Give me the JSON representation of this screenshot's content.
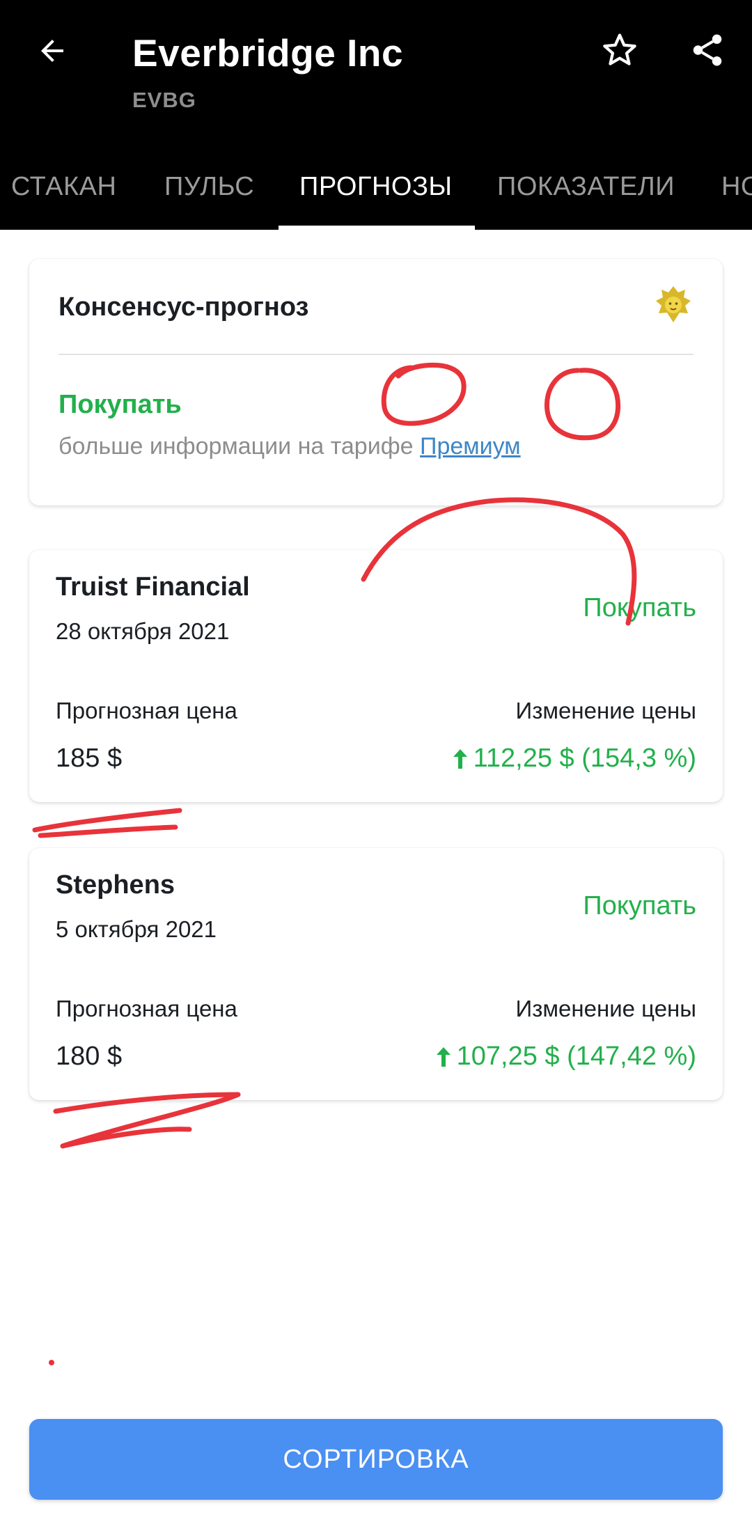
{
  "header": {
    "back_icon": "arrow-left-icon",
    "title": "Everbridge Inc",
    "ticker": "EVBG",
    "star_icon": "star-outline-icon",
    "share_icon": "share-icon"
  },
  "tabs": [
    {
      "label": "СТАКАН",
      "active": false
    },
    {
      "label": "ПУЛЬС",
      "active": false
    },
    {
      "label": "ПРОГНОЗЫ",
      "active": true
    },
    {
      "label": "ПОКАЗАТЕЛИ",
      "active": false
    },
    {
      "label": "НО",
      "active": false
    }
  ],
  "consensus": {
    "title": "Консенсус-прогноз",
    "badge_icon": "premium-lion-icon",
    "recommendation": "Покупать",
    "info_text": "больше информации на тарифе ",
    "link_text": "Премиум"
  },
  "forecasts": [
    {
      "broker": "Truist Financial",
      "date": "28 октября 2021",
      "recommendation": "Покупать",
      "price_label": "Прогнозная цена",
      "price": "185 $",
      "change_label": "Изменение цены",
      "change": "112,25 $ (154,3 %)"
    },
    {
      "broker": "Stephens",
      "date": "5 октября 2021",
      "recommendation": "Покупать",
      "price_label": "Прогнозная цена",
      "price": "180 $",
      "change_label": "Изменение цены",
      "change": "107,25 $ (147,42 %)"
    }
  ],
  "sort_button": "СОРТИРОВКА",
  "colors": {
    "header_bg": "#000000",
    "positive": "#22b04b",
    "link": "#3d86c6",
    "button": "#4a8ff2",
    "annotation": "#e8333a"
  }
}
